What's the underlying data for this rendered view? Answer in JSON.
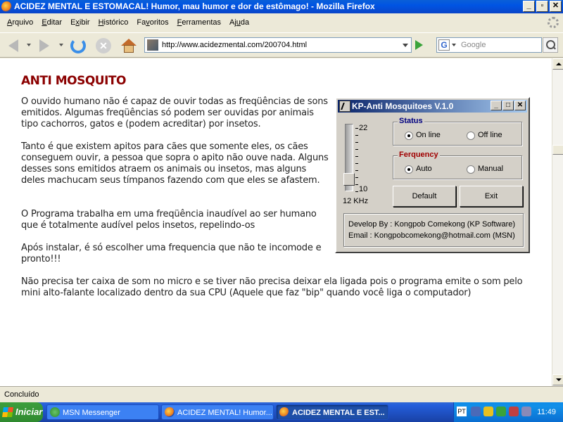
{
  "window": {
    "title": "ACIDEZ MENTAL E ESTOMACAL! Humor, mau humor e dor de estômago! - Mozilla Firefox",
    "controls": {
      "minimize": "_",
      "maximize": "▫",
      "close": "✕"
    }
  },
  "menu": {
    "items": [
      {
        "pre": "",
        "key": "A",
        "post": "rquivo"
      },
      {
        "pre": "",
        "key": "E",
        "post": "ditar"
      },
      {
        "pre": "E",
        "key": "x",
        "post": "ibir"
      },
      {
        "pre": "",
        "key": "H",
        "post": "istórico"
      },
      {
        "pre": "Fa",
        "key": "v",
        "post": "oritos"
      },
      {
        "pre": "",
        "key": "F",
        "post": "erramentas"
      },
      {
        "pre": "Aj",
        "key": "u",
        "post": "da"
      }
    ]
  },
  "nav": {
    "url": "http://www.acidezmental.com/200704.html",
    "search_placeholder": "Google",
    "search_engine_letter": "G"
  },
  "content": {
    "title": "ANTI MOSQUITO",
    "paragraphs": [
      "O ouvido humano não é capaz de ouvir todas as freqüências de sons emitidos. Algumas freqüências só podem ser ouvidas por animais tipo cachorros, gatos e (podem acreditar) por insetos.",
      "Tanto é que existem apitos para cães que somente eles, os cães conseguem ouvir, a pessoa que sopra o apito não ouve nada. Alguns desses sons emitidos atraem os animais ou insetos, mas alguns deles machucam seus tímpanos fazendo com que eles se afastem.",
      "O Programa trabalha em uma freqüência inaudível ao ser humano que é totalmente audível pelos insetos, repelindo-os",
      "Após instalar, é só escolher uma frequencia que não te incomode e pronto!!!",
      "Não precisa ter caixa de som no micro e se tiver não precisa deixar ela ligada pois o programa emite o som pelo mini alto-falante localizado dentro da sua CPU (Aquele que faz \"bip\" quando você liga o computador)"
    ]
  },
  "kp_app": {
    "title": "KP-Anti Mosquitoes V.1.0",
    "slider_top_label": "22",
    "slider_bottom_label": "10",
    "slider_value_label": "12 KHz",
    "status_group": "Status",
    "status_options": [
      "On line",
      "Off line"
    ],
    "status_selected": "On line",
    "frequency_group": "Ferquency",
    "frequency_options": [
      "Auto",
      "Manual"
    ],
    "frequency_selected": "Auto",
    "default_button": "Default",
    "exit_button": "Exit",
    "develop_by": "Develop By : Kongpob Comekong (KP Software)",
    "email": "Email : Kongpobcomekong@hotmail.com (MSN)"
  },
  "status_bar": {
    "text": "Concluído"
  },
  "taskbar": {
    "start_label": "Iniciar",
    "tasks": [
      {
        "label": "MSN Messenger",
        "active": false
      },
      {
        "label": "ACIDEZ MENTAL! Humor...",
        "active": false
      },
      {
        "label": "ACIDEZ MENTAL E EST...",
        "active": true
      }
    ],
    "language": "PT",
    "clock": "11:49"
  },
  "colors": {
    "title_accent": "#8b0000",
    "titlebar_blue": "#0054e3",
    "taskbar_blue": "#245edb",
    "start_green": "#3c9e3c"
  }
}
